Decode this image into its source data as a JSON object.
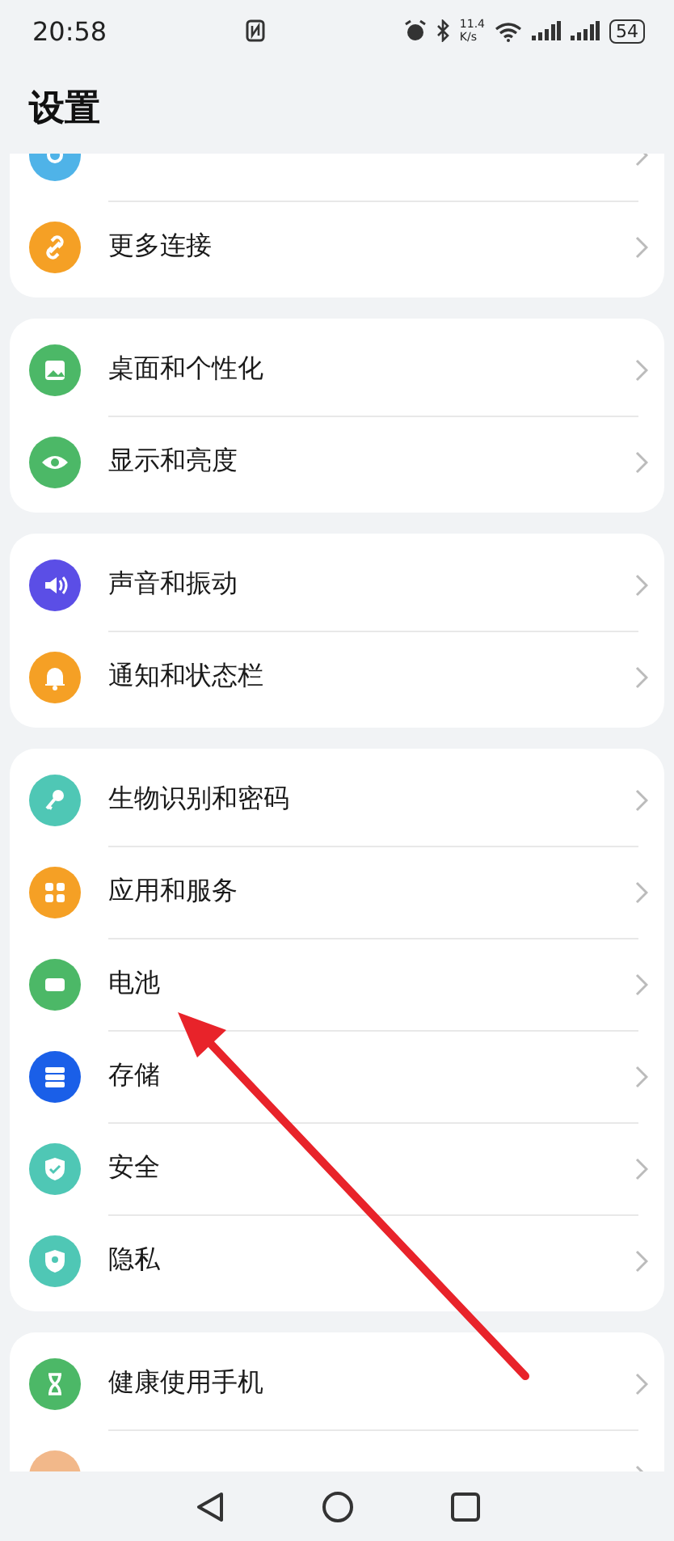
{
  "status_bar": {
    "time": "20:58",
    "net_speed": "11.4",
    "net_unit": "K/s",
    "battery": "54"
  },
  "title": "设置",
  "groups": [
    {
      "rows": [
        {
          "color": "#4fb3e8"
        },
        {
          "label": "更多连接",
          "color": "#f5a025"
        }
      ]
    },
    {
      "rows": [
        {
          "label": "桌面和个性化",
          "color": "#4cb867"
        },
        {
          "label": "显示和亮度",
          "color": "#4cb867"
        }
      ]
    },
    {
      "rows": [
        {
          "label": "声音和振动",
          "color": "#5b4ee6"
        },
        {
          "label": "通知和状态栏",
          "color": "#f5a025"
        }
      ]
    },
    {
      "rows": [
        {
          "label": "生物识别和密码",
          "color": "#4fc7b5"
        },
        {
          "label": "应用和服务",
          "color": "#f5a025"
        },
        {
          "label": "电池",
          "color": "#4cb867"
        },
        {
          "label": "存储",
          "color": "#1a5fe8"
        },
        {
          "label": "安全",
          "color": "#4fc7b5"
        },
        {
          "label": "隐私",
          "color": "#4fc7b5"
        }
      ]
    },
    {
      "rows": [
        {
          "label": "健康使用手机",
          "color": "#4cb867"
        },
        {
          "color": "#f2b88a"
        }
      ]
    }
  ]
}
